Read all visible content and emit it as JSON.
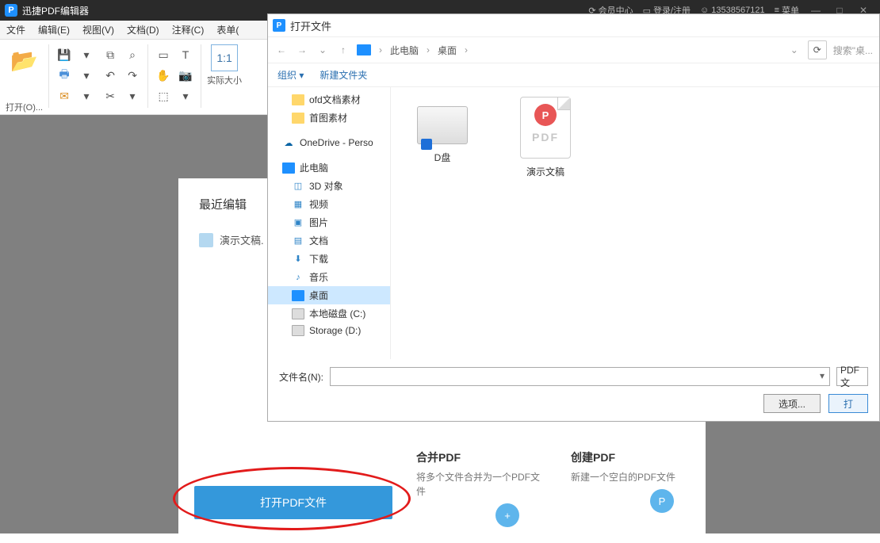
{
  "app": {
    "title": "迅捷PDF编辑器",
    "icon_letter": "P"
  },
  "titlebar": {
    "member": "会员中心",
    "login": "登录/注册",
    "phone": "13538567121",
    "menu": "菜单"
  },
  "menu": {
    "file": "文件",
    "edit": "编辑(E)",
    "view": "视图(V)",
    "doc": "文档(D)",
    "comment": "注释(C)",
    "form": "表单("
  },
  "toolbar": {
    "open": "打开(O)...",
    "size": "实际大小"
  },
  "recent": {
    "title": "最近编辑",
    "item1": "演示文稿."
  },
  "open_button": "打开PDF文件",
  "cards": {
    "merge_title": "合并PDF",
    "merge_desc": "将多个文件合并为一个PDF文件",
    "merge_btn": "+",
    "create_title": "创建PDF",
    "create_desc": "新建一个空白的PDF文件",
    "create_btn": "P"
  },
  "dialog": {
    "title": "打开文件",
    "icon_letter": "P",
    "crumb_pc": "此电脑",
    "crumb_desktop": "桌面",
    "search_placeholder": "搜索\"桌...",
    "organize": "组织",
    "new_folder": "新建文件夹",
    "tree": {
      "ofd": "ofd文档素材",
      "shoutu": "首图素材",
      "onedrive": "OneDrive - Perso",
      "thispc": "此电脑",
      "obj3d": "3D 对象",
      "video": "视频",
      "pic": "图片",
      "docf": "文档",
      "download": "下载",
      "music": "音乐",
      "desktop": "桌面",
      "cdrive": "本地磁盘 (C:)",
      "ddrive": "Storage (D:)"
    },
    "files": {
      "ddisk": "D盘",
      "demo": "演示文稿",
      "pdf_label": "PDF",
      "pdf_badge": "P"
    },
    "filename_label": "文件名(N):",
    "filter": "PDF 文",
    "options": "选项...",
    "open_btn": "打"
  }
}
